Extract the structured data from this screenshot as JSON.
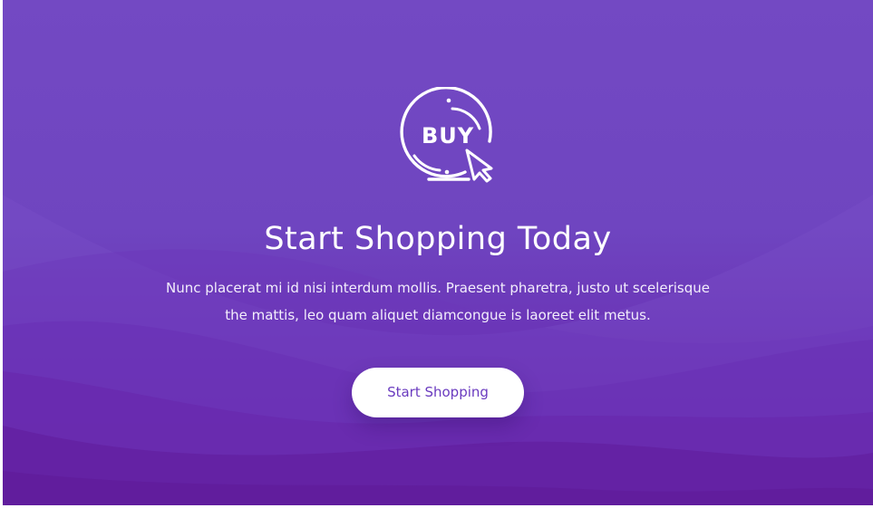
{
  "hero": {
    "icon": "buy-cursor-icon",
    "icon_text": "BUY",
    "title": "Start Shopping Today",
    "description": "Nunc placerat mi id nisi interdum mollis. Praesent pharetra, justo ut scelerisque the mattis, leo quam aliquet diamcongue is laoreet elit metus.",
    "cta_label": "Start Shopping"
  },
  "colors": {
    "background_top": "#7349c3",
    "background_bottom": "#6420a0",
    "button_background": "#ffffff",
    "button_text": "#6a3bbf",
    "text": "#ffffff"
  }
}
